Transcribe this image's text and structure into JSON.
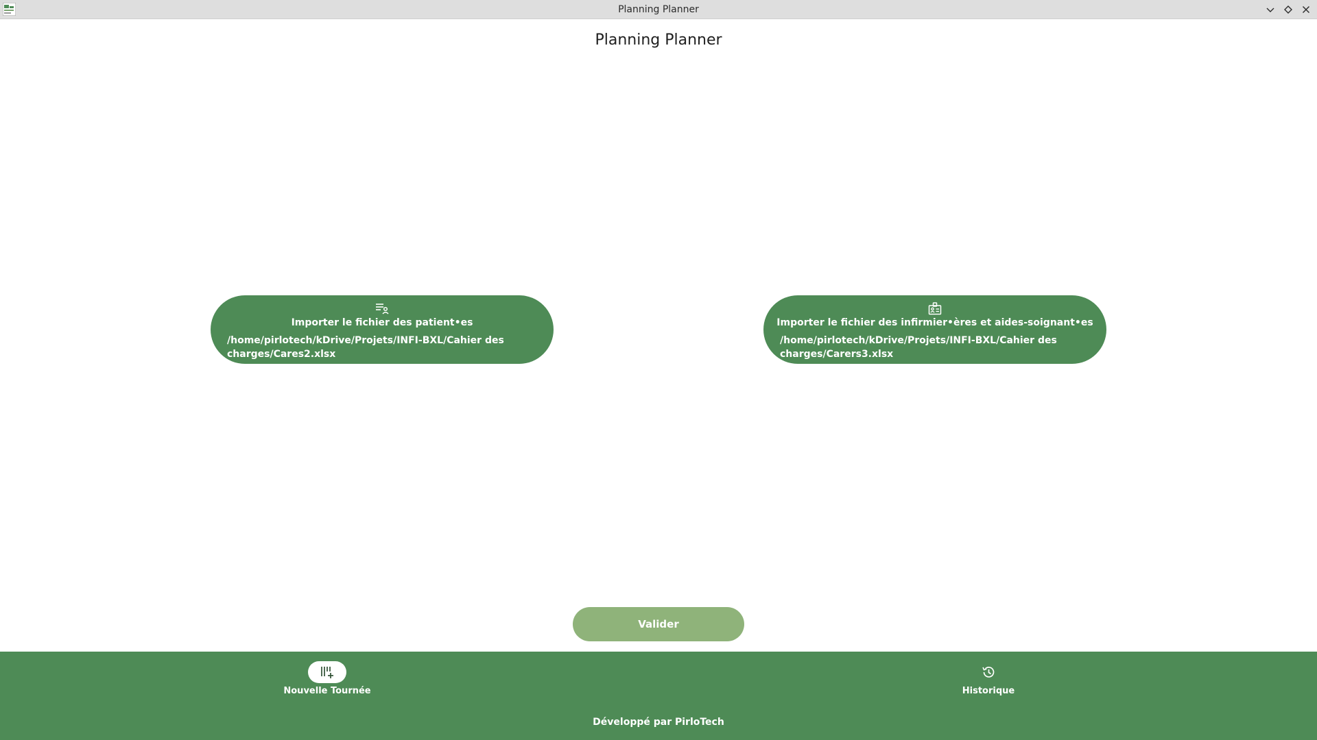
{
  "window": {
    "title": "Planning Planner",
    "controls": [
      "minimize-icon",
      "maximize-icon",
      "close-icon"
    ]
  },
  "page": {
    "title": "Planning Planner"
  },
  "imports": {
    "patients": {
      "label": "Importer le fichier des patient•es",
      "path": "/home/pirlotech/kDrive/Projets/INFI-BXL/Cahier des charges/Cares2.xlsx",
      "icon": "person-list-icon"
    },
    "carers": {
      "label": "Importer le fichier des infirmier•ères et aides-soignant•es",
      "path": "/home/pirlotech/kDrive/Projets/INFI-BXL/Cahier des charges/Carers3.xlsx",
      "icon": "badge-icon"
    }
  },
  "actions": {
    "validate_label": "Valider"
  },
  "nav": {
    "items": [
      {
        "label": "Nouvelle Tournée",
        "icon": "new-tour-icon",
        "active": true
      },
      {
        "label": "Historique",
        "icon": "history-icon",
        "active": false
      }
    ]
  },
  "footer": {
    "credit": "Développé par PirloTech"
  },
  "colors": {
    "primary": "#4e8b56",
    "disabled_button": "#8fb37a",
    "titlebar": "#dedede"
  }
}
